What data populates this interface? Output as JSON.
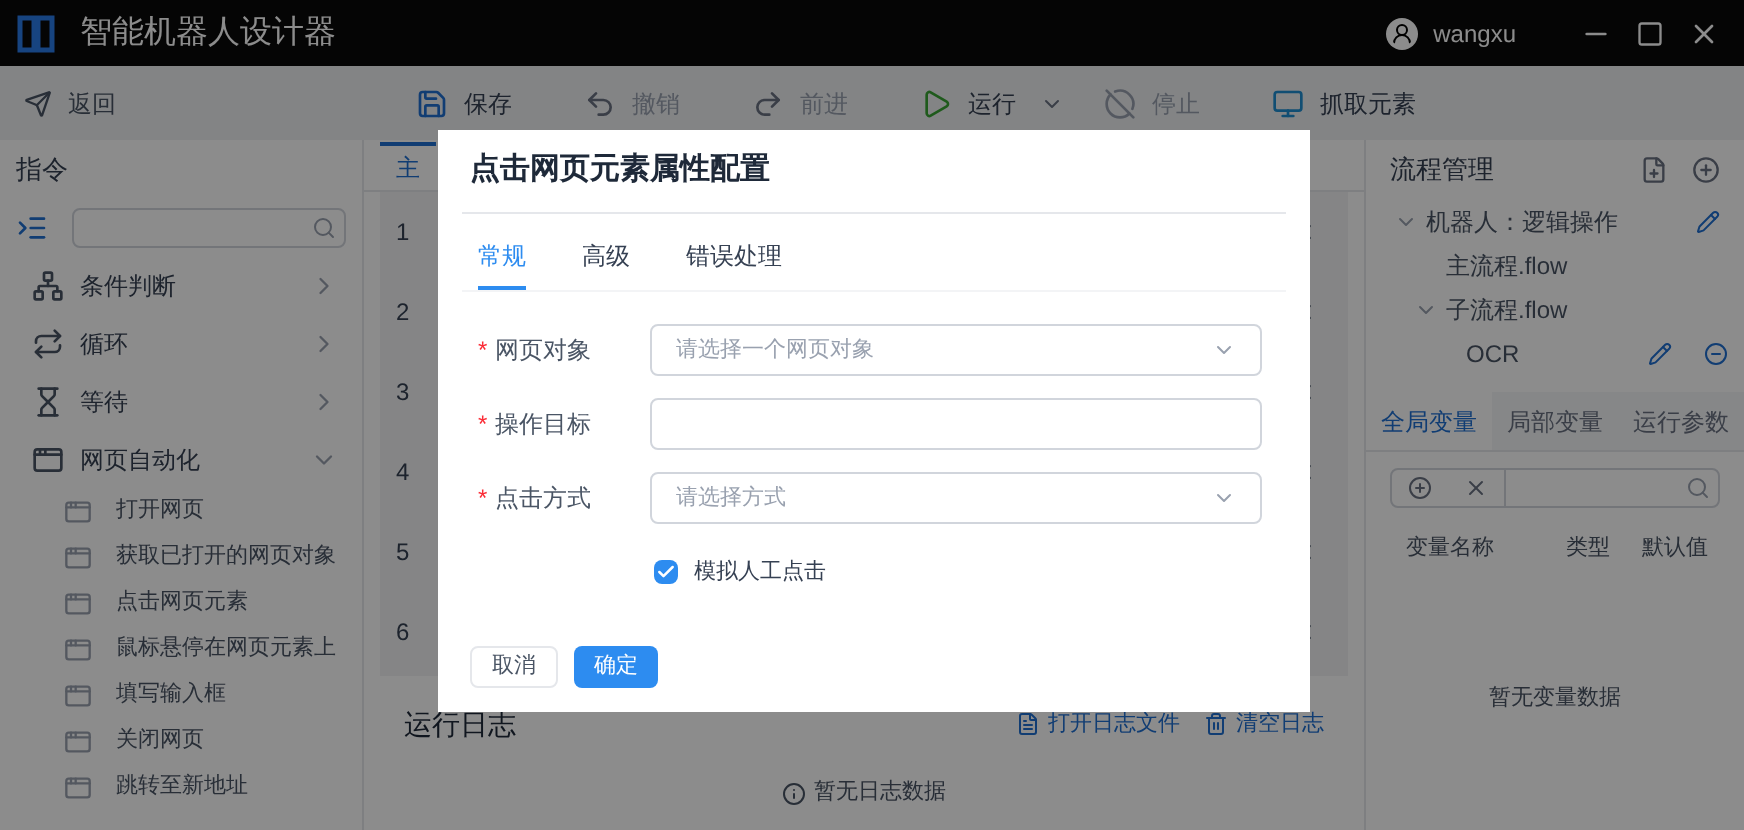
{
  "window": {
    "title": "智能机器人设计器",
    "user": "wangxu"
  },
  "toolbar": {
    "back": "返回",
    "actions": [
      {
        "kind": "save",
        "label": "保存",
        "disabled": false
      },
      {
        "kind": "undo",
        "label": "撤销",
        "disabled": true
      },
      {
        "kind": "redo",
        "label": "前进",
        "disabled": true
      },
      {
        "kind": "run",
        "label": "运行",
        "disabled": false
      },
      {
        "kind": "stop",
        "label": "停止",
        "disabled": true
      },
      {
        "kind": "capture",
        "label": "抓取元素",
        "disabled": false
      }
    ]
  },
  "sidebar": {
    "title": "指令",
    "groups": [
      {
        "kind": "branch",
        "label": "条件判断",
        "expanded": false
      },
      {
        "kind": "loop",
        "label": "循环",
        "expanded": false
      },
      {
        "kind": "wait",
        "label": "等待",
        "expanded": false
      },
      {
        "kind": "web",
        "label": "网页自动化",
        "expanded": true,
        "children": [
          "打开网页",
          "获取已打开的网页对象",
          "点击网页元素",
          "鼠标悬停在网页元素上",
          "填写输入框",
          "关闭网页",
          "跳转至新地址"
        ]
      }
    ]
  },
  "editor": {
    "tab": "主",
    "rows": [
      "1",
      "2",
      "3",
      "4",
      "5",
      "6"
    ],
    "log_title": "运行日志",
    "log_links": [
      "打开日志文件",
      "清空日志"
    ],
    "log_empty": "暂无日志数据"
  },
  "process": {
    "title": "流程管理",
    "tree": [
      {
        "label": "机器人：逻辑操作",
        "expanded": true,
        "children": [
          {
            "label": "主流程.flow"
          },
          {
            "label": "子流程.flow",
            "expanded": true,
            "children": [
              {
                "label": "OCR"
              }
            ]
          }
        ]
      }
    ],
    "var_tabs": [
      {
        "label": "全局变量",
        "selected": true
      },
      {
        "label": "局部变量",
        "selected": false
      },
      {
        "label": "运行参数",
        "selected": false
      }
    ],
    "columns": [
      "变量名称",
      "类型",
      "默认值"
    ],
    "empty": "暂无变量数据"
  },
  "dialog": {
    "title": "点击网页元素属性配置",
    "tabs": [
      {
        "label": "常规",
        "selected": true
      },
      {
        "label": "高级",
        "selected": false
      },
      {
        "label": "错误处理",
        "selected": false
      }
    ],
    "fields": [
      {
        "kind": "select",
        "label": "网页对象",
        "mark": "*",
        "placeholder": "请选择一个网页对象"
      },
      {
        "kind": "input",
        "label": "操作目标",
        "mark": "*"
      },
      {
        "kind": "select",
        "label": "点击方式",
        "mark": "*",
        "placeholder": "请选择方式"
      }
    ],
    "checkbox": {
      "label": "模拟人工点击",
      "checked": true
    },
    "buttons": [
      {
        "kind": "secondary",
        "label": "取消"
      },
      {
        "kind": "primary",
        "label": "确定"
      }
    ]
  }
}
